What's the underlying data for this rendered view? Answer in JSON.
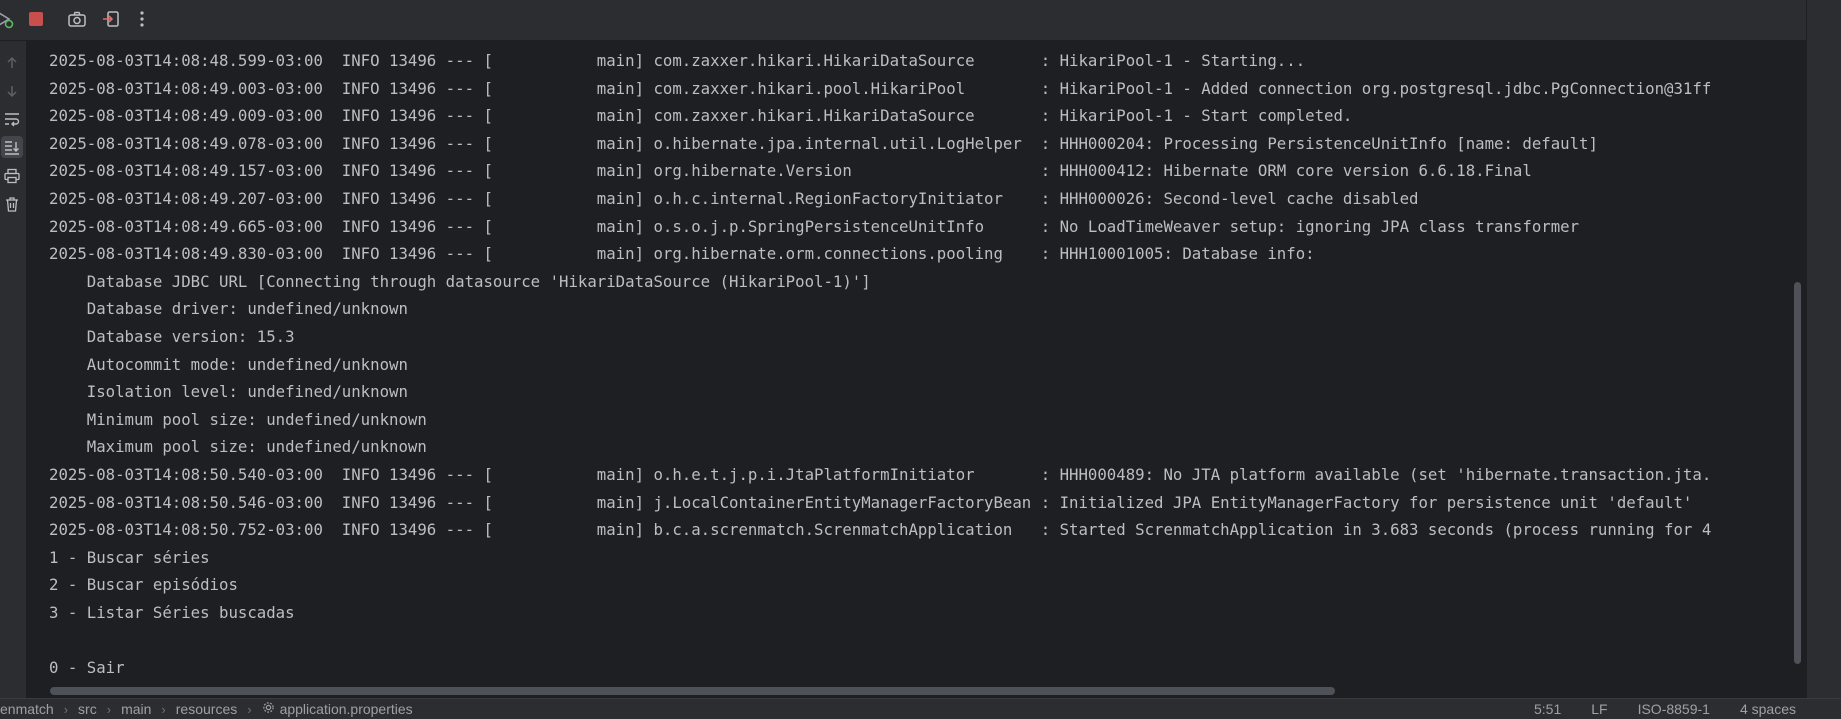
{
  "toolbar": {
    "icons": [
      "rerun-icon",
      "stop-icon",
      "camera-icon",
      "exit-icon",
      "more-options-icon"
    ]
  },
  "sidebar": {
    "icons": [
      "arrow-up-icon",
      "arrow-down-icon",
      "soft-wrap-icon",
      "scroll-to-end-icon",
      "print-icon",
      "trash-icon"
    ]
  },
  "console": {
    "lines": [
      "2025-08-03T14:08:48.599-03:00  INFO 13496 --- [           main] com.zaxxer.hikari.HikariDataSource       : HikariPool-1 - Starting...",
      "2025-08-03T14:08:49.003-03:00  INFO 13496 --- [           main] com.zaxxer.hikari.pool.HikariPool        : HikariPool-1 - Added connection org.postgresql.jdbc.PgConnection@31ff",
      "2025-08-03T14:08:49.009-03:00  INFO 13496 --- [           main] com.zaxxer.hikari.HikariDataSource       : HikariPool-1 - Start completed.",
      "2025-08-03T14:08:49.078-03:00  INFO 13496 --- [           main] o.hibernate.jpa.internal.util.LogHelper  : HHH000204: Processing PersistenceUnitInfo [name: default]",
      "2025-08-03T14:08:49.157-03:00  INFO 13496 --- [           main] org.hibernate.Version                    : HHH000412: Hibernate ORM core version 6.6.18.Final",
      "2025-08-03T14:08:49.207-03:00  INFO 13496 --- [           main] o.h.c.internal.RegionFactoryInitiator    : HHH000026: Second-level cache disabled",
      "2025-08-03T14:08:49.665-03:00  INFO 13496 --- [           main] o.s.o.j.p.SpringPersistenceUnitInfo      : No LoadTimeWeaver setup: ignoring JPA class transformer",
      "2025-08-03T14:08:49.830-03:00  INFO 13496 --- [           main] org.hibernate.orm.connections.pooling    : HHH10001005: Database info:",
      "    Database JDBC URL [Connecting through datasource 'HikariDataSource (HikariPool-1)']",
      "    Database driver: undefined/unknown",
      "    Database version: 15.3",
      "    Autocommit mode: undefined/unknown",
      "    Isolation level: undefined/unknown",
      "    Minimum pool size: undefined/unknown",
      "    Maximum pool size: undefined/unknown",
      "2025-08-03T14:08:50.540-03:00  INFO 13496 --- [           main] o.h.e.t.j.p.i.JtaPlatformInitiator       : HHH000489: No JTA platform available (set 'hibernate.transaction.jta.",
      "2025-08-03T14:08:50.546-03:00  INFO 13496 --- [           main] j.LocalContainerEntityManagerFactoryBean : Initialized JPA EntityManagerFactory for persistence unit 'default'",
      "2025-08-03T14:08:50.752-03:00  INFO 13496 --- [           main] b.c.a.screnmatch.ScrenmatchApplication   : Started ScrenmatchApplication in 3.683 seconds (process running for 4",
      "1 - Buscar séries",
      "2 - Buscar episódios",
      "3 - Listar Séries buscadas",
      "",
      "0 - Sair"
    ]
  },
  "statusbar": {
    "breadcrumbs": [
      "enmatch",
      "src",
      "main",
      "resources",
      "application.properties"
    ],
    "position": "5:51",
    "line_separator": "LF",
    "encoding": "ISO-8859-1",
    "indent": "4 spaces"
  }
}
